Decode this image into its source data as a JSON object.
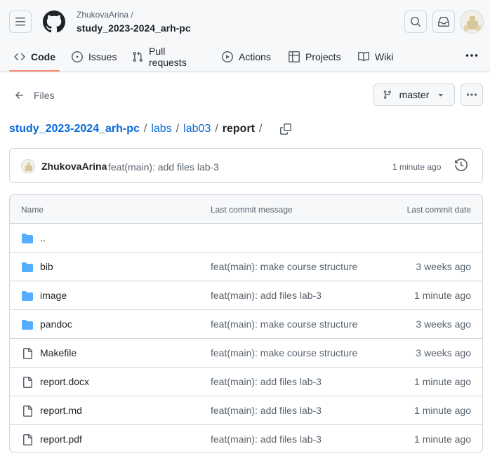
{
  "repo": {
    "owner": "ZhukovaArina /",
    "name": "study_2023-2024_arh-pc"
  },
  "nav": {
    "tabs": [
      {
        "label": "Code",
        "icon": "code-icon"
      },
      {
        "label": "Issues",
        "icon": "issue-opened-icon"
      },
      {
        "label": "Pull requests",
        "icon": "git-pull-request-icon"
      },
      {
        "label": "Actions",
        "icon": "play-icon"
      },
      {
        "label": "Projects",
        "icon": "table-icon"
      },
      {
        "label": "Wiki",
        "icon": "book-icon"
      }
    ],
    "active_tab": "Code"
  },
  "files_nav": {
    "label": "Files",
    "branch": "master"
  },
  "breadcrumb": {
    "repo": "study_2023-2024_arh-pc",
    "parts": [
      "labs",
      "lab03"
    ],
    "current": "report",
    "sep": "/"
  },
  "latest_commit": {
    "author": "ZhukovaArina",
    "message": "feat(main): add files lab-3",
    "time": "1 minute ago"
  },
  "table": {
    "headers": {
      "name": "Name",
      "message": "Last commit message",
      "date": "Last commit date"
    },
    "rows": [
      {
        "name": "..",
        "type": "folder",
        "message": "",
        "date": ""
      },
      {
        "name": "bib",
        "type": "folder",
        "message": "feat(main): make course structure",
        "date": "3 weeks ago"
      },
      {
        "name": "image",
        "type": "folder",
        "message": "feat(main): add files lab-3",
        "date": "1 minute ago"
      },
      {
        "name": "pandoc",
        "type": "folder",
        "message": "feat(main): make course structure",
        "date": "3 weeks ago"
      },
      {
        "name": "Makefile",
        "type": "file",
        "message": "feat(main): make course structure",
        "date": "3 weeks ago"
      },
      {
        "name": "report.docx",
        "type": "file",
        "message": "feat(main): add files lab-3",
        "date": "1 minute ago"
      },
      {
        "name": "report.md",
        "type": "file",
        "message": "feat(main): add files lab-3",
        "date": "1 minute ago"
      },
      {
        "name": "report.pdf",
        "type": "file",
        "message": "feat(main): add files lab-3",
        "date": "1 minute ago"
      }
    ]
  },
  "colors": {
    "link": "#0969da",
    "folder": "#54aeff",
    "tab_underline": "#fd8c73",
    "border": "#d0d7de",
    "muted": "#59636e"
  }
}
